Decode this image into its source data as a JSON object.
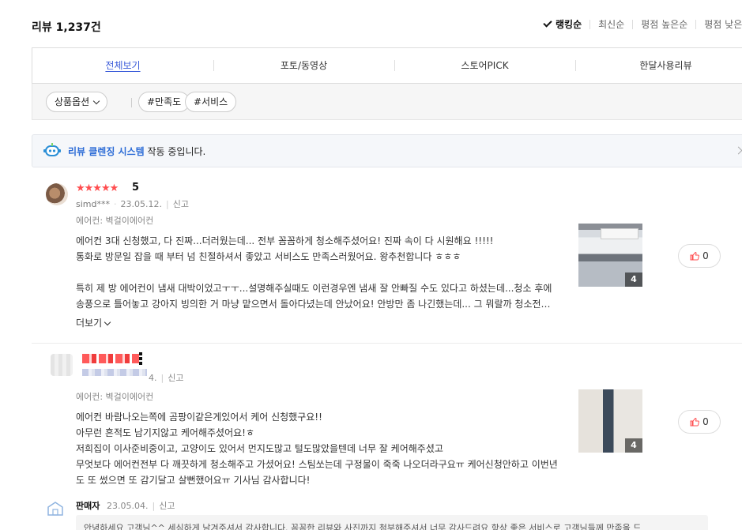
{
  "header": {
    "review_count": "리뷰 1,237건",
    "sort_options": [
      "랭킹순",
      "최신순",
      "평점 높은순",
      "평점 낮은순"
    ],
    "active_sort": "랭킹순"
  },
  "tabs": [
    "전체보기",
    "포토/동영상",
    "스토어PICK",
    "한달사용리뷰"
  ],
  "filters": {
    "option_label": "상품옵션",
    "tags": [
      "#만족도",
      "#서비스"
    ]
  },
  "cleaning_banner": {
    "highlight": "리뷰 클렌징 시스템",
    "text": " 작동 중입니다."
  },
  "reviews": [
    {
      "stars": "★★★★★",
      "score": "5",
      "user": "simd***",
      "date": "23.05.12.",
      "report": "신고",
      "option": "에어컨: 벽걸이에어컨",
      "lines": [
        "에어컨 3대 신청했고, 다 진짜...더러웠는데... 전부 꼼꼼하게 청소해주셨어요! 진짜 속이 다 시원해요 !!!!!",
        "통화로 방문일 잡을 때 부터 넘 친절하셔서 좋았고 서비스도 만족스러웠어요. 왕추천합니다 ㅎㅎㅎ",
        "",
        "  특히 제 방 에어컨이 냄새 대박이었고ㅜㅜ...설명해주실때도 이런경우엔 냄새 잘 안빠질 수도 있다고 하셨는데...청소 후에",
        "송풍으로 틀어놓고 강아지 빙의한 거 마냥 맡으면서 돌아다녔는데 안났어요! 안방만 좀 나긴했는데... 그 뭐랄까 청소전이 ..."
      ],
      "more": "더보기",
      "photo_count": "4",
      "likes": "0"
    },
    {
      "date_suffix": "4.",
      "report": "신고",
      "option": "에어컨: 벽걸이에어컨",
      "lines": [
        "에어컨 바람나오는쪽에 곰팡이같은게있어서 케어 신청했구요!!",
        "아무런 흔적도 남기지않고 케어해주셨어요!ㅎ",
        "저희집이 이사준비중이고, 고양이도 있어서 먼지도많고 털도많았을텐데 너무 잘 케어해주셨고",
        "무엇보다 에어컨전부 다 깨끗하게 청소해주고 가셨어요! 스팀쏘는데 구정물이 죽죽 나오더라구요ㅠ 케어신청안하고 이번년",
        "도 또 썼으면 또 감기달고 살뻔했어요ㅠ 기사님 감사합니다!"
      ],
      "photo_count": "4",
      "likes": "0"
    }
  ],
  "seller_reply": {
    "name": "판매자",
    "date": "23.05.04.",
    "report": "신고",
    "text": "안녕하세요 고객님^^ 세심하게 남겨주셔서 감사합니다. 꼼꼼한 리뷰와 사진까지 첨부해주셔서 너무 감사드려요 항상 좋은 서비스로 고객님들께 만족을 드"
  },
  "colors": {
    "accent": "#3a5bd9",
    "star": "#ff4d4f",
    "cleaning_highlight": "#2b6bd6"
  }
}
